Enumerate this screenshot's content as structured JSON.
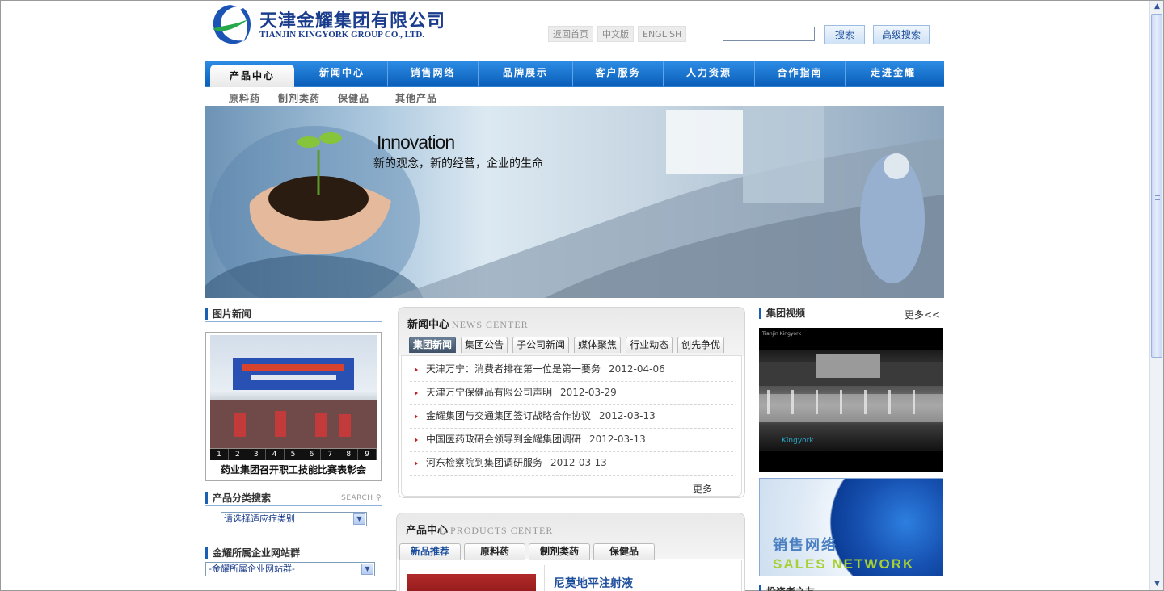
{
  "header": {
    "logo_cn": "天津金耀集团有限公司",
    "logo_en": "TIANJIN KINGYORK GROUP CO., LTD.",
    "links": [
      "返回首页",
      "中文版",
      "ENGLISH"
    ],
    "search_value": "",
    "search_button": "搜索",
    "advanced_search_button": "高级搜索"
  },
  "nav": {
    "items": [
      "产品中心",
      "新闻中心",
      "销售网络",
      "品牌展示",
      "客户服务",
      "人力资源",
      "合作指南",
      "走进金耀"
    ],
    "active_index": 0
  },
  "subnav": [
    "原料药",
    "制剂类药",
    "保健品",
    "其他产品"
  ],
  "banner": {
    "title": "Innovation",
    "subtitle": "新的观念，新的经营，企业的生命"
  },
  "photo_news": {
    "title": "图片新闻",
    "pager": [
      "1",
      "2",
      "3",
      "4",
      "5",
      "6",
      "7",
      "8",
      "9"
    ],
    "caption": "药业集团召开职工技能比赛表彰会"
  },
  "product_search": {
    "title": "产品分类搜索",
    "tag": "SEARCH",
    "select_value": "请选择适应症类别"
  },
  "sites": {
    "title": "金耀所属企业网站群",
    "select_value": "-金耀所属企业网站群-"
  },
  "news_center": {
    "title_cn": "新闻中心",
    "title_en": "NEWS CENTER",
    "tabs": [
      "集团新闻",
      "集团公告",
      "子公司新闻",
      "媒体聚焦",
      "行业动态",
      "创先争优"
    ],
    "active_tab": 0,
    "items": [
      {
        "title": "天津万宁：消费者排在第一位是第一要务",
        "date": "2012-04-06"
      },
      {
        "title": "天津万宁保健品有限公司声明",
        "date": "2012-03-29"
      },
      {
        "title": "金耀集团与交通集团签订战略合作协议",
        "date": "2012-03-13"
      },
      {
        "title": "中国医药政研会领导到金耀集团调研",
        "date": "2012-03-13"
      },
      {
        "title": "河东检察院到集团调研服务",
        "date": "2012-03-13"
      }
    ],
    "more": "更多"
  },
  "products_center": {
    "title_cn": "产品中心",
    "title_en": "PRODUCTS CENTER",
    "tabs": [
      "新品推荐",
      "原料药",
      "制剂类药",
      "保健品"
    ],
    "active_tab": 0,
    "featured_name": "尼莫地平注射液"
  },
  "video": {
    "title": "集团视频",
    "more": "更多<<",
    "overlay_text": "Tianjin Kingyork",
    "brand": "Kingyork"
  },
  "sales_network": {
    "cn": "销售网络",
    "en": "SALES NETWORK"
  },
  "investor": {
    "title": "投资者之友"
  },
  "colors": {
    "nav_blue": "#0a5fb9",
    "accent": "#1a5fb3",
    "news_dot": "#c02020"
  }
}
